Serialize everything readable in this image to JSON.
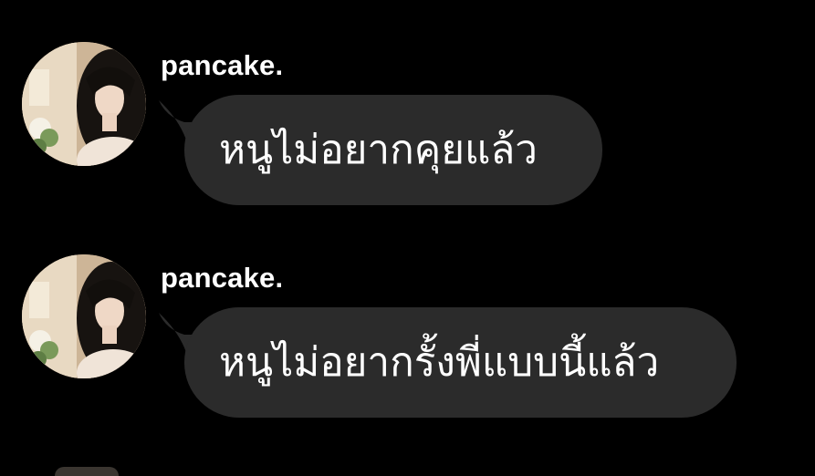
{
  "messages": [
    {
      "sender": "pancake.",
      "text": "หนูไม่อยากคุยแล้ว"
    },
    {
      "sender": "pancake.",
      "text": "หนูไม่อยากรั้งพี่แบบนี้แล้ว"
    }
  ],
  "colors": {
    "background": "#000000",
    "bubble": "#2b2b2b",
    "text": "#ffffff"
  }
}
